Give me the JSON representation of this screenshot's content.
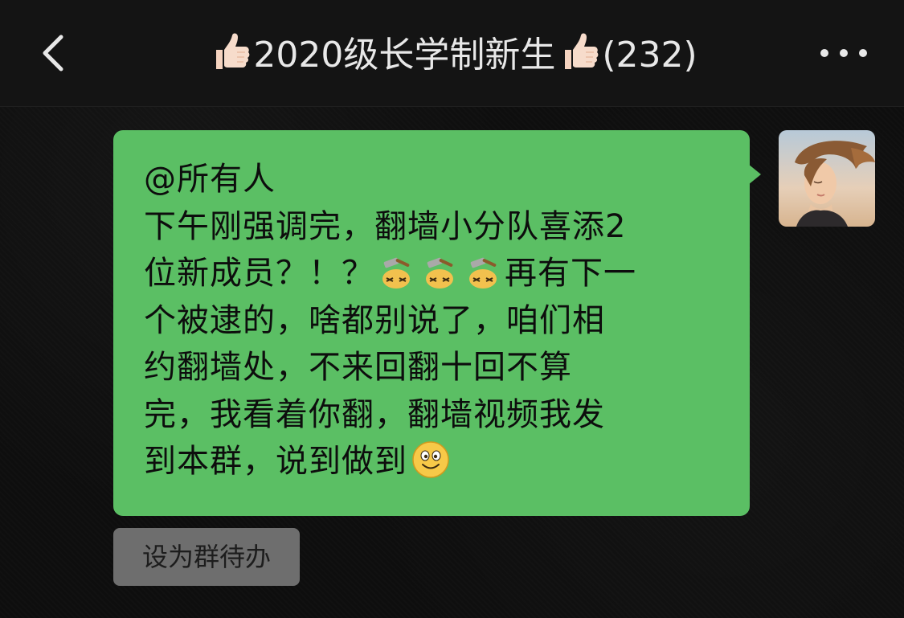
{
  "header": {
    "title_prefix_icon": "thumbs-up-emoji",
    "title_text": "2020级长学制新生",
    "title_suffix_icon": "thumbs-up-emoji",
    "member_count": "(232)",
    "back_icon": "chevron-left-icon",
    "more_icon": "more-dots-icon"
  },
  "message": {
    "sender_avatar": "avatar-girl-windswept-hair",
    "bubble_color": "#5bbf64",
    "lines": [
      "@所有人",
      "下午刚强调完，翻墙小分队喜添2",
      "位新成员？！？",
      "再有下一",
      "个被逮的，啥都别说了，咱们相",
      "约翻墙处，不来回翻十回不算",
      "完，我看着你翻，翻墙视频我发",
      "到本群，说到做到"
    ],
    "inline_emojis": [
      "hammer-head-emoji",
      "hammer-head-emoji",
      "hammer-head-emoji",
      "smile-emoji"
    ]
  },
  "actions": {
    "todo_label": "设为群待办"
  },
  "colors": {
    "header_bg": "#141414",
    "chat_bg": "#0e0e0e",
    "bubble": "#5bbf64",
    "todo_btn": "#6e6e6e"
  }
}
